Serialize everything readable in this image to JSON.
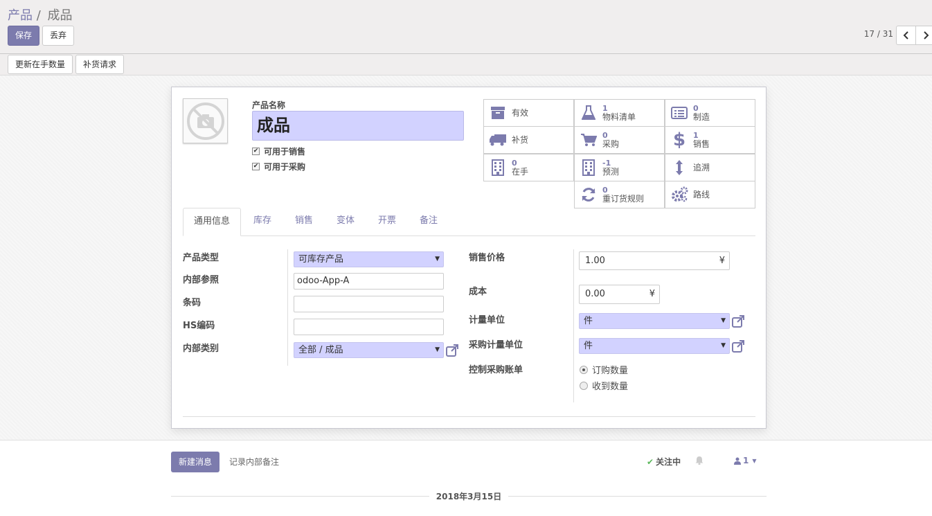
{
  "breadcrumb": {
    "parent": "产品",
    "separator": "/",
    "current": "成品"
  },
  "toolbar": {
    "save_label": "保存",
    "discard_label": "丢弃"
  },
  "pager": {
    "value": "17 / 31"
  },
  "statusbar": {
    "update_qty_label": "更新在手数量",
    "replenish_label": "补货请求"
  },
  "product": {
    "name_label": "产品名称",
    "name": "成品",
    "can_be_sold_label": "可用于销售",
    "can_be_sold": true,
    "can_be_purchased_label": "可用于采购",
    "can_be_purchased": true
  },
  "smart_buttons": [
    {
      "icon": "archive-icon",
      "count": "",
      "label": "有效"
    },
    {
      "icon": "flask-icon",
      "count": "1",
      "label": "物料清单"
    },
    {
      "icon": "list-icon",
      "count": "0",
      "label": "制造"
    },
    {
      "icon": "truck-icon",
      "count": "",
      "label": "补货"
    },
    {
      "icon": "cart-icon",
      "count": "0",
      "label": "采购"
    },
    {
      "icon": "dollar-icon",
      "count": "1",
      "label": "销售"
    },
    {
      "icon": "building-icon",
      "count": "0",
      "label": "在手"
    },
    {
      "icon": "building-icon",
      "count": "-1",
      "label": "预测"
    },
    {
      "icon": "arrows-v-icon",
      "count": "",
      "label": "追溯"
    },
    {
      "icon": "refresh-icon",
      "count": "0",
      "label": "重订货规则"
    },
    {
      "icon": "cogs-icon",
      "count": "",
      "label": "路线"
    }
  ],
  "tabs": [
    "通用信息",
    "库存",
    "销售",
    "变体",
    "开票",
    "备注"
  ],
  "active_tab": "通用信息",
  "general": {
    "type_label": "产品类型",
    "type_value": "可库存产品",
    "ref_label": "内部参照",
    "ref_value": "odoo-App-A",
    "barcode_label": "条码",
    "barcode_value": "",
    "hs_label": "HS编码",
    "hs_value": "",
    "categ_label": "内部类别",
    "categ_value": "全部 / 成品",
    "price_label": "销售价格",
    "price_value": "1.00",
    "price_currency": "¥",
    "cost_label": "成本",
    "cost_value": "0.00",
    "cost_currency": "¥",
    "uom_label": "计量单位",
    "uom_value": "件",
    "uom_po_label": "采购计量单位",
    "uom_po_value": "件",
    "bill_label": "控制采购账单",
    "bill_options": [
      "订购数量",
      "收到数量"
    ],
    "bill_selected": "订购数量"
  },
  "chatter": {
    "new_message_label": "新建消息",
    "log_note_label": "记录内部备注",
    "following_label": "关注中",
    "followers_count": "1",
    "date_separator": "2018年3月15日"
  },
  "colors": {
    "primary": "#7c7bad",
    "required_field": "#d2d2ff"
  }
}
